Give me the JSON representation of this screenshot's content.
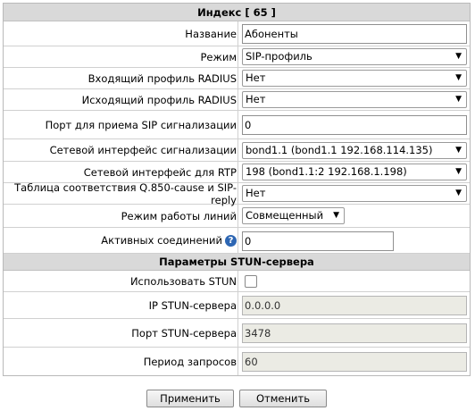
{
  "header": {
    "title": "Индекс [ 65 ]"
  },
  "form": {
    "name": {
      "label": "Название",
      "value": "Абоненты"
    },
    "mode": {
      "label": "Режим",
      "value": "SIP-профиль"
    },
    "incoming_radius": {
      "label": "Входящий профиль RADIUS",
      "value": "Нет"
    },
    "outgoing_radius": {
      "label": "Исходящий профиль RADIUS",
      "value": "Нет"
    },
    "sip_port": {
      "label": "Порт для приема SIP сигнализации",
      "value": "0"
    },
    "sig_iface": {
      "label": "Сетевой интерфейс сигнализации",
      "value": "bond1.1 (bond1.1 192.168.114.135)"
    },
    "rtp_iface": {
      "label": "Сетевой интерфейс для RTP",
      "value": "198 (bond1.1:2 192.168.1.198)"
    },
    "q850_table": {
      "label": "Таблица соответствия Q.850-cause и SIP-reply",
      "value": "Нет"
    },
    "line_mode": {
      "label": "Режим работы линий",
      "value": "Совмещенный"
    },
    "active_conn": {
      "label": "Активных соединений",
      "value": "0"
    }
  },
  "stun": {
    "title": "Параметры STUN-сервера",
    "use": {
      "label": "Использовать STUN",
      "checked": false
    },
    "ip": {
      "label": "IP STUN-сервера",
      "value": "0.0.0.0"
    },
    "port": {
      "label": "Порт STUN-сервера",
      "value": "3478"
    },
    "period": {
      "label": "Период запросов",
      "value": "60"
    }
  },
  "buttons": {
    "apply": "Применить",
    "cancel": "Отменить"
  },
  "icons": {
    "dropdown": "caret-down-icon",
    "help": "help-icon"
  },
  "colors": {
    "header_bg": "#d9d9d9",
    "help_icon": "#2d66b3",
    "disabled_input": "#ebebe4"
  }
}
